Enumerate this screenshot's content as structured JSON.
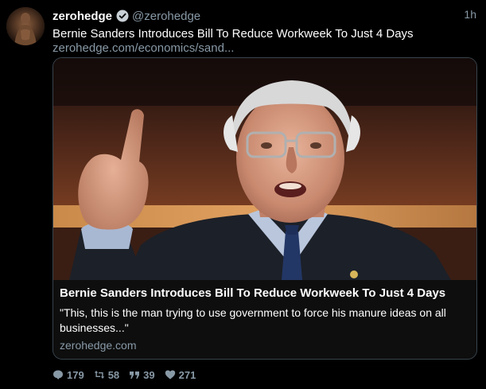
{
  "tweet": {
    "display_name": "zerohedge",
    "handle": "@zerohedge",
    "time": "1h",
    "text": "Bernie Sanders Introduces Bill To Reduce Workweek To Just 4 Days",
    "link": "zerohedge.com/economics/sand...",
    "verified": true
  },
  "card": {
    "title": "Bernie Sanders Introduces Bill To Reduce Workweek To Just 4 Days",
    "description": "\"This, this is the man trying to use government to force his manure ideas on all businesses...\"",
    "domain": "zerohedge.com"
  },
  "actions": {
    "replies": "179",
    "retweets": "58",
    "quotes": "39",
    "likes": "271"
  },
  "icons": {
    "verified": "verified-badge-icon",
    "reply": "reply-icon",
    "retweet": "retweet-icon",
    "quote": "quote-icon",
    "like": "heart-icon"
  },
  "colors": {
    "background": "#000000",
    "text": "#ffffff",
    "muted": "#8899a6",
    "border": "#38444d"
  }
}
